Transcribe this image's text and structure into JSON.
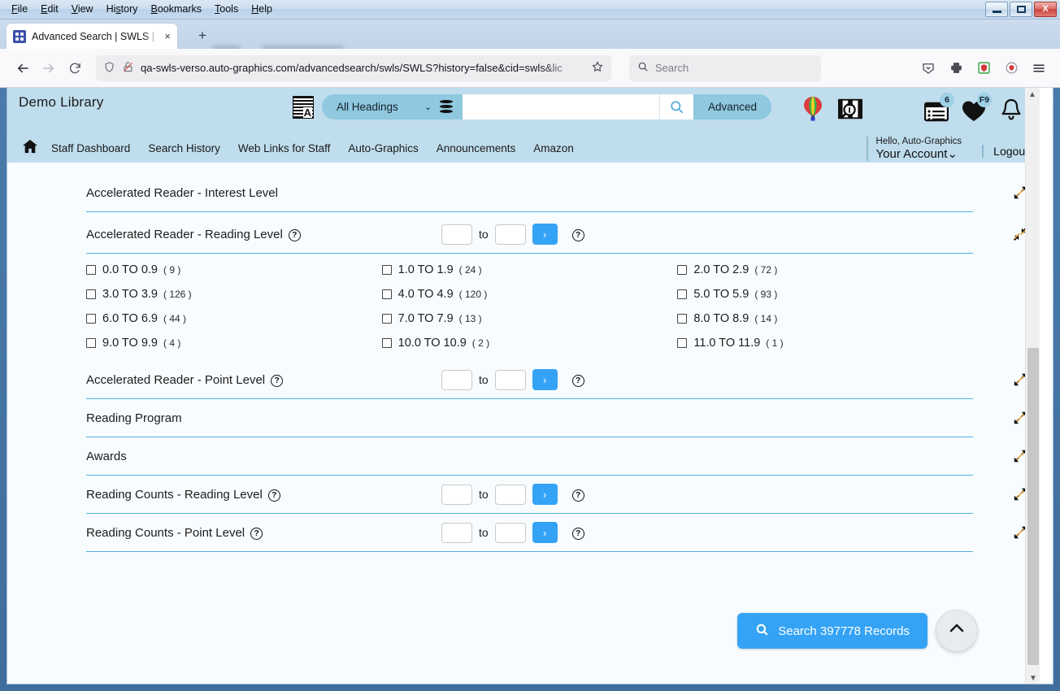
{
  "os": {
    "menus": [
      "File",
      "Edit",
      "View",
      "History",
      "Bookmarks",
      "Tools",
      "Help"
    ],
    "minimize_label": "Minimize",
    "maximize_label": "Maximize",
    "close_label": "X"
  },
  "browser": {
    "tab_title": "Advanced Search | SWLS | SWLS",
    "tab_close": "×",
    "new_tab": "+",
    "url": "qa-swls-verso.auto-graphics.com/advancedsearch/swls/SWLS?history=false&cid=swls&lic",
    "search_placeholder": "Search",
    "back": "←",
    "forward": "→",
    "reload": "↻"
  },
  "app": {
    "brand": "Demo Library",
    "search": {
      "scope_label": "All Headings",
      "query_value": "",
      "advanced_label": "Advanced"
    },
    "account": {
      "hello": "Hello, Auto-Graphics",
      "your_account": "Your Account",
      "logout": "Logout"
    },
    "badges": {
      "list": "6",
      "favorites": "F9"
    },
    "nav": [
      "Staff Dashboard",
      "Search History",
      "Web Links for Staff",
      "Auto-Graphics",
      "Announcements",
      "Amazon"
    ]
  },
  "facets": [
    {
      "title": "Accelerated Reader - Interest Level",
      "has_help": false,
      "has_range": false,
      "state": "collapsed"
    },
    {
      "title": "Accelerated Reader - Reading Level",
      "has_help": true,
      "has_range": true,
      "state": "expanded",
      "range": {
        "from": "",
        "to_label": "to",
        "to": "",
        "go_label": "›"
      }
    },
    {
      "title": "Accelerated Reader - Point Level",
      "has_help": true,
      "has_range": true,
      "state": "collapsed",
      "range": {
        "from": "",
        "to_label": "to",
        "to": "",
        "go_label": "›"
      }
    },
    {
      "title": "Reading Program",
      "has_help": false,
      "has_range": false,
      "state": "collapsed"
    },
    {
      "title": "Awards",
      "has_help": false,
      "has_range": false,
      "state": "collapsed"
    },
    {
      "title": "Reading Counts - Reading Level",
      "has_help": true,
      "has_range": true,
      "state": "collapsed",
      "range": {
        "from": "",
        "to_label": "to",
        "to": "",
        "go_label": "›"
      }
    },
    {
      "title": "Reading Counts - Point Level",
      "has_help": true,
      "has_range": true,
      "state": "collapsed",
      "range": {
        "from": "",
        "to_label": "to",
        "to": "",
        "go_label": "›"
      }
    }
  ],
  "reading_level_options": [
    {
      "label": "0.0 TO 0.9",
      "count": "( 9 )",
      "checked": false
    },
    {
      "label": "1.0 TO 1.9",
      "count": "( 24 )",
      "checked": false
    },
    {
      "label": "2.0 TO 2.9",
      "count": "( 72 )",
      "checked": false
    },
    {
      "label": "3.0 TO 3.9",
      "count": "( 126 )",
      "checked": false
    },
    {
      "label": "4.0 TO 4.9",
      "count": "( 120 )",
      "checked": false
    },
    {
      "label": "5.0 TO 5.9",
      "count": "( 93 )",
      "checked": false
    },
    {
      "label": "6.0 TO 6.9",
      "count": "( 44 )",
      "checked": false
    },
    {
      "label": "7.0 TO 7.9",
      "count": "( 13 )",
      "checked": false
    },
    {
      "label": "8.0 TO 8.9",
      "count": "( 14 )",
      "checked": false
    },
    {
      "label": "9.0 TO 9.9",
      "count": "( 4 )",
      "checked": false
    },
    {
      "label": "10.0 TO 10.9",
      "count": "( 2 )",
      "checked": false
    },
    {
      "label": "11.0 TO 11.9",
      "count": "( 1 )",
      "checked": false
    }
  ],
  "actions": {
    "search_records_label": "Search 397778 Records",
    "scroll_top_label": "Back to top"
  },
  "colors": {
    "accent_blue": "#35a3f5",
    "header_blue": "#bfdded",
    "pill_blue": "#8fc8df",
    "divider_blue": "#4fb3e3",
    "content_bg": "#f8fcff"
  }
}
